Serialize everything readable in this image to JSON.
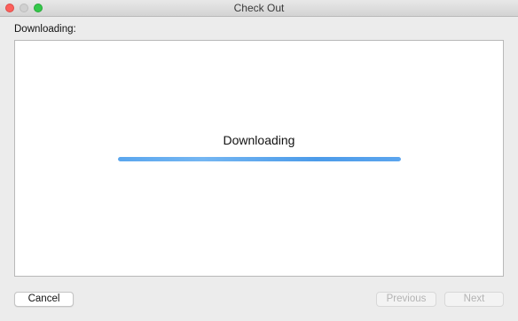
{
  "window": {
    "title": "Check Out"
  },
  "section": {
    "label": "Downloading:"
  },
  "progress": {
    "status": "Downloading",
    "fraction": 1.0,
    "color": "#4c9be9"
  },
  "buttons": {
    "cancel": "Cancel",
    "previous": "Previous",
    "next": "Next"
  },
  "colors": {
    "close": "#fc605c",
    "minimize": "#d0d0d0",
    "zoom": "#34c84a"
  }
}
